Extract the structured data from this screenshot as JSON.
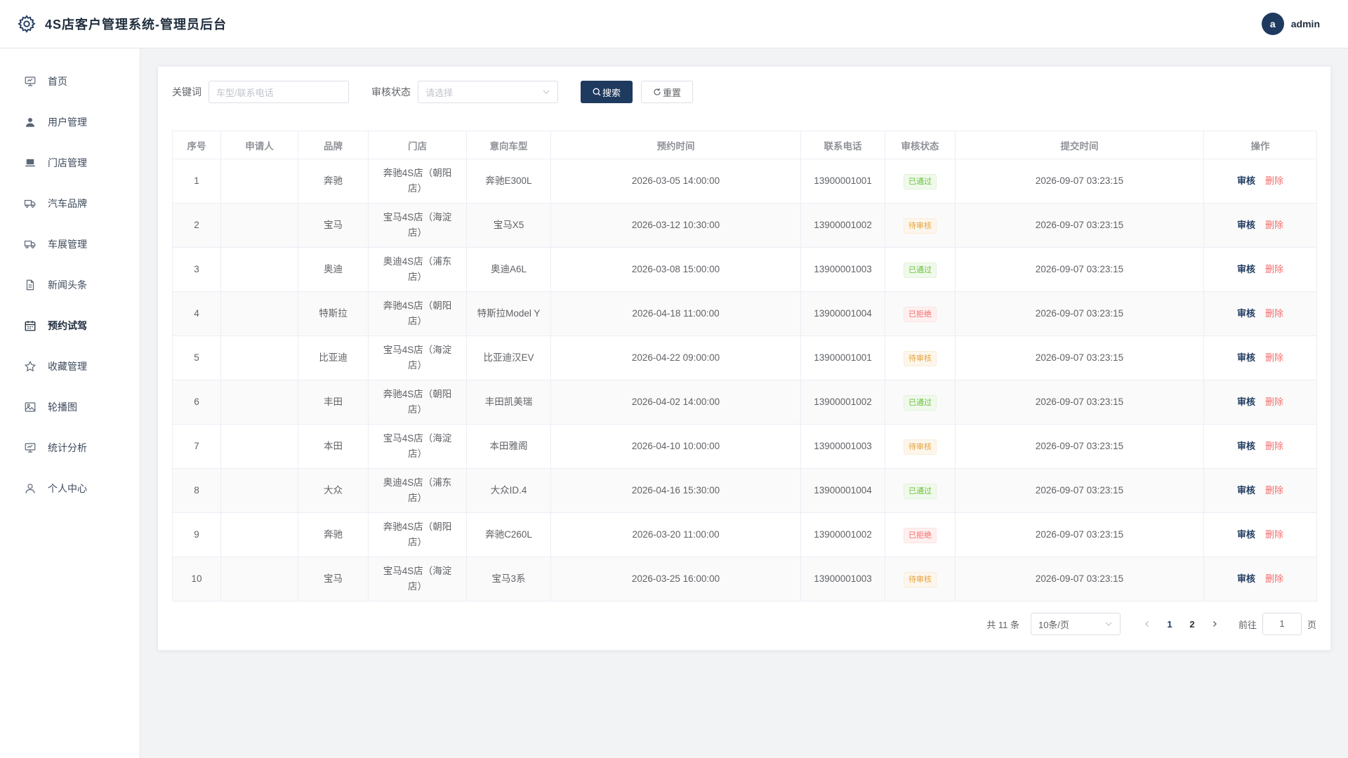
{
  "header": {
    "title": "4S店客户管理系统-管理员后台",
    "avatar_letter": "a",
    "username": "admin"
  },
  "sidebar": {
    "items": [
      {
        "label": "首页",
        "icon": "monitor-icon"
      },
      {
        "label": "用户管理",
        "icon": "user-filled-icon"
      },
      {
        "label": "门店管理",
        "icon": "store-icon"
      },
      {
        "label": "汽车品牌",
        "icon": "truck-icon"
      },
      {
        "label": "车展管理",
        "icon": "truck-icon"
      },
      {
        "label": "新闻头条",
        "icon": "document-icon"
      },
      {
        "label": "预约试驾",
        "icon": "calendar-icon",
        "active": true
      },
      {
        "label": "收藏管理",
        "icon": "star-icon"
      },
      {
        "label": "轮播图",
        "icon": "picture-icon"
      },
      {
        "label": "统计分析",
        "icon": "monitor-icon"
      },
      {
        "label": "个人中心",
        "icon": "user-icon"
      }
    ]
  },
  "filters": {
    "keyword_label": "关键词",
    "keyword_placeholder": "车型/联系电话",
    "status_label": "审核状态",
    "status_placeholder": "请选择",
    "search_label": "搜索",
    "reset_label": "重置"
  },
  "table": {
    "headers": [
      "序号",
      "申请人",
      "品牌",
      "门店",
      "意向车型",
      "预约时间",
      "联系电话",
      "审核状态",
      "提交时间",
      "操作"
    ],
    "review_label": "审核",
    "delete_label": "删除",
    "rows": [
      {
        "no": "1",
        "applicant": "",
        "brand": "奔驰",
        "store": "奔驰4S店（朝阳店）",
        "model": "奔驰E300L",
        "time": "2026-03-05 14:00:00",
        "phone": "13900001001",
        "status": "已通过",
        "status_type": "ok",
        "submitted": "2026-09-07 03:23:15"
      },
      {
        "no": "2",
        "applicant": "",
        "brand": "宝马",
        "store": "宝马4S店（海淀店）",
        "model": "宝马X5",
        "time": "2026-03-12 10:30:00",
        "phone": "13900001002",
        "status": "待审核",
        "status_type": "wait",
        "submitted": "2026-09-07 03:23:15"
      },
      {
        "no": "3",
        "applicant": "",
        "brand": "奥迪",
        "store": "奥迪4S店（浦东店）",
        "model": "奥迪A6L",
        "time": "2026-03-08 15:00:00",
        "phone": "13900001003",
        "status": "已通过",
        "status_type": "ok",
        "submitted": "2026-09-07 03:23:15"
      },
      {
        "no": "4",
        "applicant": "",
        "brand": "特斯拉",
        "store": "奔驰4S店（朝阳店）",
        "model": "特斯拉Model Y",
        "time": "2026-04-18 11:00:00",
        "phone": "13900001004",
        "status": "已拒绝",
        "status_type": "no",
        "submitted": "2026-09-07 03:23:15"
      },
      {
        "no": "5",
        "applicant": "",
        "brand": "比亚迪",
        "store": "宝马4S店（海淀店）",
        "model": "比亚迪汉EV",
        "time": "2026-04-22 09:00:00",
        "phone": "13900001001",
        "status": "待审核",
        "status_type": "wait",
        "submitted": "2026-09-07 03:23:15"
      },
      {
        "no": "6",
        "applicant": "",
        "brand": "丰田",
        "store": "奔驰4S店（朝阳店）",
        "model": "丰田凯美瑞",
        "time": "2026-04-02 14:00:00",
        "phone": "13900001002",
        "status": "已通过",
        "status_type": "ok",
        "submitted": "2026-09-07 03:23:15"
      },
      {
        "no": "7",
        "applicant": "",
        "brand": "本田",
        "store": "宝马4S店（海淀店）",
        "model": "本田雅阁",
        "time": "2026-04-10 10:00:00",
        "phone": "13900001003",
        "status": "待审核",
        "status_type": "wait",
        "submitted": "2026-09-07 03:23:15"
      },
      {
        "no": "8",
        "applicant": "",
        "brand": "大众",
        "store": "奥迪4S店（浦东店）",
        "model": "大众ID.4",
        "time": "2026-04-16 15:30:00",
        "phone": "13900001004",
        "status": "已通过",
        "status_type": "ok",
        "submitted": "2026-09-07 03:23:15"
      },
      {
        "no": "9",
        "applicant": "",
        "brand": "奔驰",
        "store": "奔驰4S店（朝阳店）",
        "model": "奔驰C260L",
        "time": "2026-03-20 11:00:00",
        "phone": "13900001002",
        "status": "已拒绝",
        "status_type": "no",
        "submitted": "2026-09-07 03:23:15"
      },
      {
        "no": "10",
        "applicant": "",
        "brand": "宝马",
        "store": "宝马4S店（海淀店）",
        "model": "宝马3系",
        "time": "2026-03-25 16:00:00",
        "phone": "13900001003",
        "status": "待审核",
        "status_type": "wait",
        "submitted": "2026-09-07 03:23:15"
      }
    ]
  },
  "pagination": {
    "total_text": "共 11 条",
    "page_size": "10条/页",
    "pages": [
      "1",
      "2"
    ],
    "current_page": "1",
    "goto_label": "前往",
    "goto_value": "1",
    "page_unit": "页"
  },
  "colors": {
    "primary": "#1f3a5f",
    "success": "#67c23a",
    "warning": "#e6a23c",
    "danger": "#f56c6c"
  }
}
